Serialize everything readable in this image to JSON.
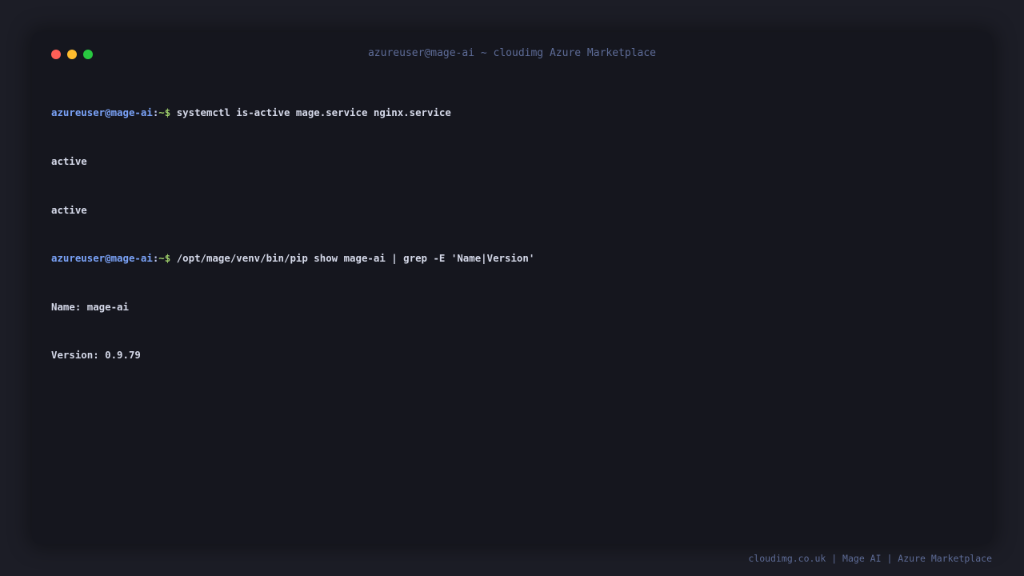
{
  "window": {
    "title": "azureuser@mage-ai ~ cloudimg Azure Marketplace",
    "lights": [
      {
        "name": "close",
        "color": "#fe5f57"
      },
      {
        "name": "minimize",
        "color": "#febc2e"
      },
      {
        "name": "maximize",
        "color": "#28c840"
      }
    ]
  },
  "terminal": {
    "prompt": {
      "user_host": "azureuser@mage-ai",
      "separator": ":",
      "path": "~",
      "symbol": "$"
    },
    "lines": [
      {
        "type": "command",
        "text": "systemctl is-active mage.service nginx.service"
      },
      {
        "type": "output",
        "text": "active"
      },
      {
        "type": "output",
        "text": "active"
      },
      {
        "type": "command",
        "text": "/opt/mage/venv/bin/pip show mage-ai | grep -E 'Name|Version'"
      },
      {
        "type": "output",
        "text": "Name: mage-ai"
      },
      {
        "type": "output",
        "text": "Version: 0.9.79"
      }
    ]
  },
  "footer": {
    "text": "cloudimg.co.uk | Mage AI | Azure Marketplace"
  },
  "colors": {
    "background": "#1c1d26",
    "window": "#15161e",
    "prompt_user": "#7aa2f7",
    "prompt_path": "#9ece6a",
    "muted": "#5d6b96"
  }
}
